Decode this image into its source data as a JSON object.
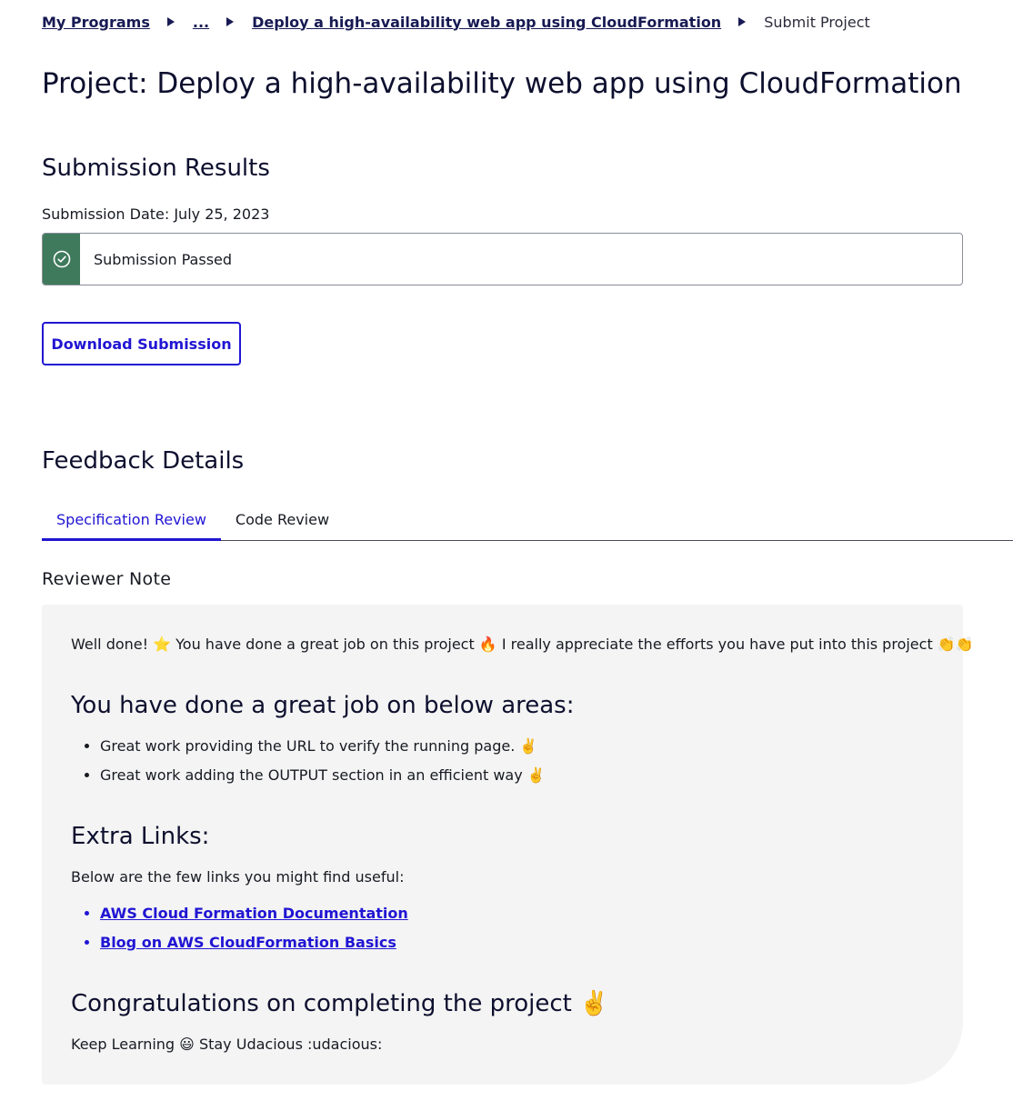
{
  "breadcrumb": {
    "items": [
      "My Programs",
      "...",
      "Deploy a high-availability web app using CloudFormation"
    ],
    "current": "Submit Project"
  },
  "page_title": "Project: Deploy a high-availability web app using CloudFormation",
  "submission_results": {
    "heading": "Submission Results",
    "date_label": "Submission Date: July 25, 2023",
    "status_text": "Submission Passed",
    "status_icon": "check-circle-icon",
    "status_color": "#3f7a5c",
    "download_label": "Download Submission"
  },
  "feedback": {
    "heading": "Feedback Details",
    "tabs": [
      {
        "label": "Specification Review",
        "active": true
      },
      {
        "label": "Code Review",
        "active": false
      }
    ],
    "reviewer_label": "Reviewer Note"
  },
  "note": {
    "intro": "Well done! ⭐ You have done a great job on this project 🔥 I really appreciate the efforts you have put into this project 👏👏",
    "areas_heading": "You have done a great job on below areas:",
    "areas": [
      "Great work providing the URL to verify the running page. ✌️",
      "Great work adding the OUTPUT section in an efficient way ✌️"
    ],
    "links_heading": "Extra Links:",
    "links_intro": "Below are the few links you might find useful:",
    "links": [
      "AWS Cloud Formation Documentation",
      "Blog on AWS CloudFormation Basics"
    ],
    "congrats_heading": "Congratulations on completing the project ✌️",
    "closing": "Keep Learning 😃 Stay Udacious :udacious:"
  },
  "colors": {
    "accent": "#2015d3",
    "text_dark": "#171a53",
    "success": "#3f7a5c",
    "note_bg": "#f4f4f4"
  }
}
